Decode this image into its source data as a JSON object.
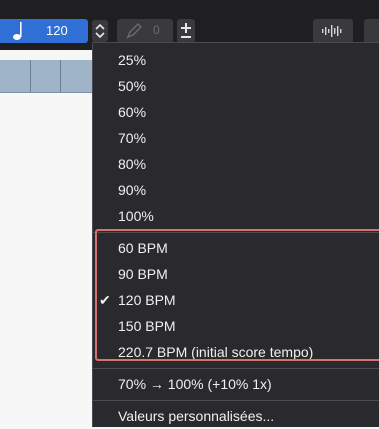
{
  "toolbar": {
    "tempo_value": "120",
    "pen_value": "0",
    "colors": {
      "tempo_bg": "#2f6fd6",
      "toolbar_bg": "#1f1f22",
      "highlight": "#d9726f"
    }
  },
  "menu": {
    "percent_items": [
      {
        "label": "25%"
      },
      {
        "label": "50%"
      },
      {
        "label": "60%"
      },
      {
        "label": "70%"
      },
      {
        "label": "80%"
      },
      {
        "label": "90%"
      },
      {
        "label": "100%"
      }
    ],
    "bpm_items": [
      {
        "label": "60 BPM",
        "checked": false
      },
      {
        "label": "90 BPM",
        "checked": false
      },
      {
        "label": "120 BPM",
        "checked": true
      },
      {
        "label": "150 BPM",
        "checked": false
      },
      {
        "label": "220.7 BPM (initial score tempo)",
        "checked": false
      }
    ],
    "ramp_item": "70% → 100% (+10% 1x)",
    "custom_item": "Valeurs personnalisées..."
  },
  "icons": {
    "note": "quarter-note-icon",
    "stepper": "stepper-icon",
    "pen": "pen-icon",
    "plusminus": "plus-minus-icon",
    "wave": "waveform-icon",
    "check": "checkmark-icon"
  }
}
